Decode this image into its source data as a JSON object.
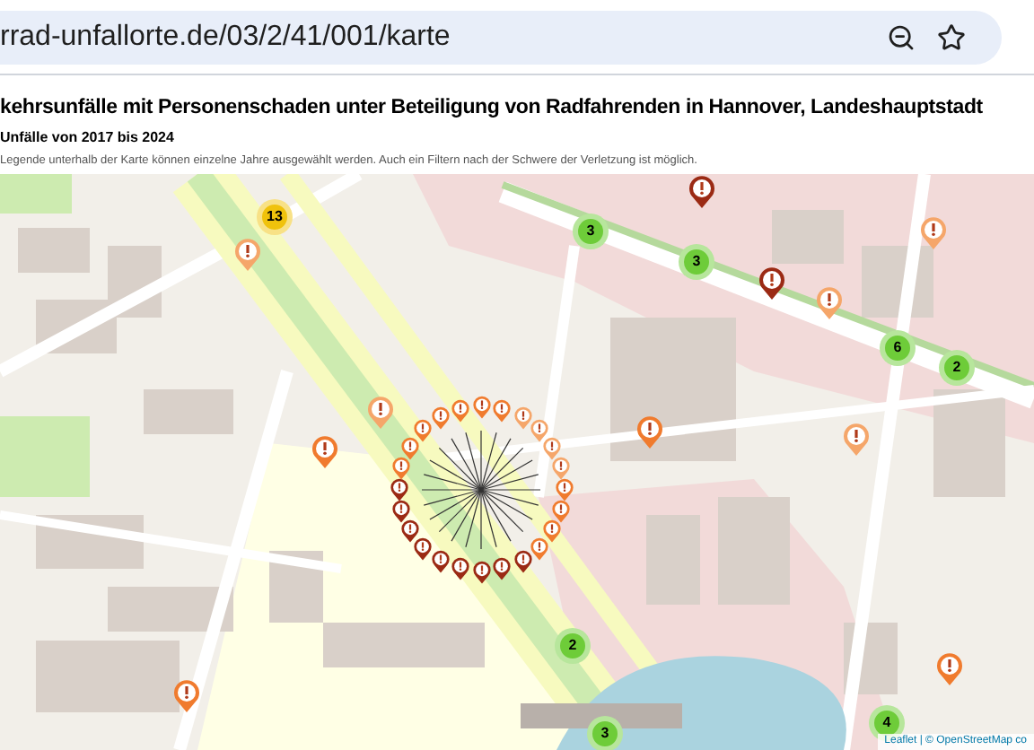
{
  "browser": {
    "url": "rrad-unfallorte.de/03/2/41/001/karte"
  },
  "page": {
    "title": "kehrsunfälle mit Personenschaden unter Beteiligung von Radfahrenden in Hannover, Landeshauptstadt",
    "subtitle": "Unfälle von 2017 bis 2024",
    "description": "Legende unterhalb der Karte können einzelne Jahre ausgewählt werden. Auch ein Filtern nach der Schwere der Verletzung ist möglich."
  },
  "map": {
    "clusters": [
      {
        "count": "13",
        "color": "#f0c20c"
      },
      {
        "count": "3",
        "color": "#6ecc39"
      },
      {
        "count": "3",
        "color": "#6ecc39"
      },
      {
        "count": "6",
        "color": "#6ecc39"
      },
      {
        "count": "2",
        "color": "#6ecc39"
      },
      {
        "count": "2",
        "color": "#6ecc39"
      },
      {
        "count": "4",
        "color": "#6ecc39"
      },
      {
        "count": "3",
        "color": "#6ecc39"
      }
    ],
    "markers": [
      {
        "color": "#f5a66a"
      },
      {
        "color": "#f07b2e"
      },
      {
        "color": "#f5a66a"
      },
      {
        "color": "#9b2a14"
      },
      {
        "color": "#9b2a14"
      },
      {
        "color": "#f5a66a"
      },
      {
        "color": "#f5a66a"
      },
      {
        "color": "#f07b2e"
      },
      {
        "color": "#f5a66a"
      },
      {
        "color": "#f07b2e"
      },
      {
        "color": "#f07b2e"
      }
    ],
    "spider_markers": [
      {
        "color": "#f07b2e"
      },
      {
        "color": "#f07b2e"
      },
      {
        "color": "#f07b2e"
      },
      {
        "color": "#f07b2e"
      },
      {
        "color": "#9b2a14"
      },
      {
        "color": "#9b2a14"
      },
      {
        "color": "#9b2a14"
      },
      {
        "color": "#9b2a14"
      },
      {
        "color": "#9b2a14"
      },
      {
        "color": "#9b2a14"
      },
      {
        "color": "#9b2a14"
      },
      {
        "color": "#9b2a14"
      },
      {
        "color": "#9b2a14"
      },
      {
        "color": "#f07b2e"
      },
      {
        "color": "#f07b2e"
      },
      {
        "color": "#f07b2e"
      },
      {
        "color": "#f07b2e"
      },
      {
        "color": "#f07b2e"
      },
      {
        "color": "#f07b2e"
      },
      {
        "color": "#f07b2e"
      },
      {
        "color": "#f5a66a"
      },
      {
        "color": "#f5a66a"
      },
      {
        "color": "#f5a66a"
      },
      {
        "color": "#f5a66a"
      }
    ],
    "attribution": "Leaflet | © OpenStreetMap co"
  }
}
